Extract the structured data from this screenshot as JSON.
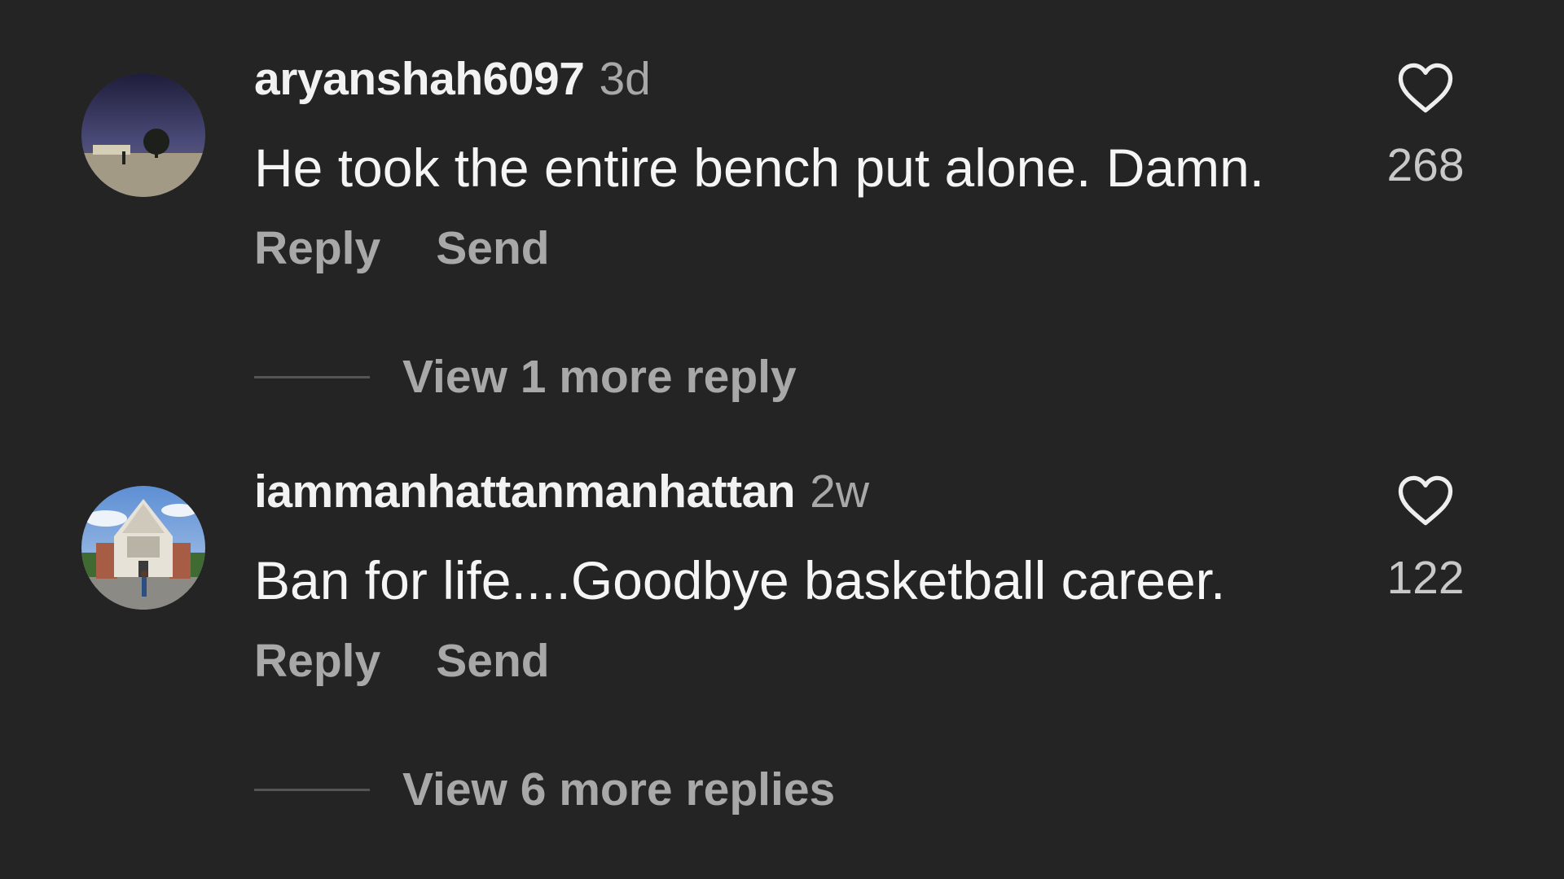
{
  "comments": [
    {
      "username": "aryanshah6097",
      "time": "3d",
      "text": "He took the entire bench put alone. Damn.",
      "likes": "268",
      "reply_label": "Reply",
      "send_label": "Send",
      "view_replies": "View 1 more reply"
    },
    {
      "username": "iammanhattanmanhattan",
      "time": "2w",
      "text": "Ban for life....Goodbye basketball career.",
      "likes": "122",
      "reply_label": "Reply",
      "send_label": "Send",
      "view_replies": "View 6 more replies"
    }
  ],
  "icons": {
    "like": "heart-icon"
  },
  "colors": {
    "background": "#242424",
    "primary_text": "#f5f5f5",
    "secondary_text": "#a8a8a8"
  }
}
